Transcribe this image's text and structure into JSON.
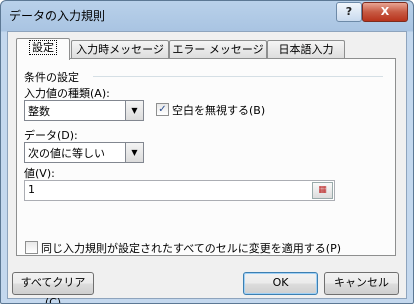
{
  "window": {
    "title": "データの入力規則",
    "help_label": "?",
    "close_label": "X"
  },
  "tabs": [
    {
      "label": "設定",
      "active": true
    },
    {
      "label": "入力時メッセージ",
      "active": false
    },
    {
      "label": "エラー メッセージ",
      "active": false
    },
    {
      "label": "日本語入力",
      "active": false
    }
  ],
  "settings": {
    "group_label": "条件の設定",
    "allow_label": "入力値の種類(A):",
    "allow_value": "整数",
    "ignore_blank_label": "空白を無視する(B)",
    "ignore_blank_checked": true,
    "data_label": "データ(D):",
    "data_value": "次の値に等しい",
    "value_label": "値(V):",
    "value_value": "1",
    "apply_all_label": "同じ入力規則が設定されたすべてのセルに変更を適用する(P)",
    "apply_all_checked": false
  },
  "buttons": {
    "clear_all": "すべてクリア(C)",
    "ok": "OK",
    "cancel": "キャンセル"
  },
  "icons": {
    "dropdown": "chevron-down-icon",
    "range_picker": "range-selector-icon",
    "checkmark": "check-icon"
  },
  "colors": {
    "title_bar": "#b9d1ea",
    "close_button": "#c75a43",
    "dialog_bg": "#f0f0f0",
    "focus_border": "#3c7fb1"
  }
}
